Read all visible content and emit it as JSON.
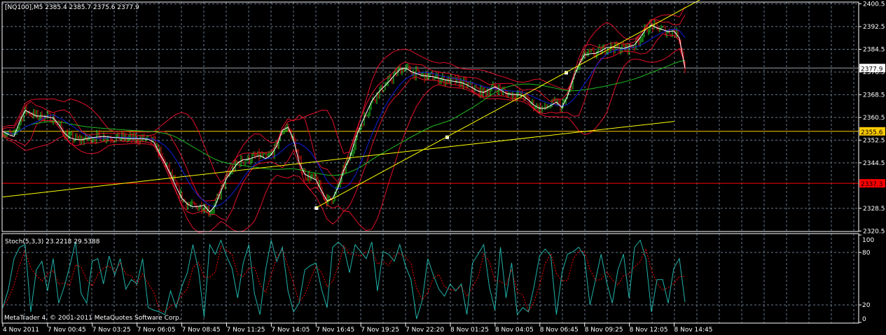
{
  "header": {
    "symbol_info": "[NQ100],M5  2385.4 2385.7 2375.6 2377.9"
  },
  "stoch_panel": {
    "label": "Stoch(5,3,3) 23.2218 29.5388",
    "copyright": "MetaTrader 4, © 2001-2011 MetaQuotes Software Corp."
  },
  "colors": {
    "background": "#000000",
    "grid": "#6a7a8c",
    "frame": "#ffffff",
    "bar_up": "#22dd22",
    "bar_down": "#ee1111",
    "ma_fast": "#ffffff",
    "ma_mid": "#1020e0",
    "ma_slow": "#22bb22",
    "bands": "#e0102a",
    "trendline": "#ffff00",
    "level_bid": "#9aa0a8",
    "level_yellow": "#ffcc00",
    "level_red": "#ff0000",
    "stoch_main": "#20b2aa",
    "stoch_signal": "#ff0000"
  },
  "chart_data": [
    {
      "type": "line",
      "title": "[NQ100],M5",
      "timeframe": "M5",
      "ohlc_last": {
        "open": 2385.4,
        "high": 2385.7,
        "low": 2375.6,
        "close": 2377.9
      },
      "y_ticks": [
        "2400.5",
        "2392.5",
        "2384.5",
        "2376.5",
        "2368.5",
        "2360.5",
        "2352.5",
        "2344.5",
        "2328.5",
        "2320.5"
      ],
      "ylim": [
        2320.5,
        2400.5
      ],
      "x_ticks": [
        "4 Nov 2011",
        "7 Nov 00:45",
        "7 Nov 03:25",
        "7 Nov 06:05",
        "7 Nov 08:45",
        "7 Nov 11:25",
        "7 Nov 14:05",
        "7 Nov 16:45",
        "7 Nov 19:25",
        "7 Nov 22:20",
        "8 Nov 01:25",
        "8 Nov 04:05",
        "8 Nov 06:45",
        "8 Nov 09:25",
        "8 Nov 12:05",
        "8 Nov 14:45"
      ],
      "grid": true,
      "price_levels": [
        {
          "label": "2377.9",
          "value": 2377.9,
          "color": "#9aa0a8",
          "label_bg": "#ffffff",
          "label_fg": "#000000"
        },
        {
          "label": "2355.6",
          "value": 2355.6,
          "color": "#ffcc00",
          "label_bg": "#ffcc00",
          "label_fg": "#000000"
        },
        {
          "label": "2337.3",
          "value": 2337.3,
          "color": "#ff0000",
          "label_bg": "#ff0000",
          "label_fg": "#000000"
        }
      ],
      "trendlines": [
        {
          "from": {
            "time": "4 Nov 2011",
            "price": 2332.5
          },
          "to": {
            "time": "8 Nov 14:45",
            "price": 2359.1
          }
        },
        {
          "from": {
            "time": "7 Nov 16:45",
            "price": 2328.7
          },
          "to": {
            "time": "8 Nov 14:45",
            "price": 2397.0
          }
        }
      ],
      "series": [
        {
          "values": [
            2355.6,
            2354.5,
            2353.8,
            2359,
            2363,
            2362,
            2361,
            2361,
            2360.7,
            2360.3,
            2358,
            2355,
            2353.3,
            2352.8,
            2352.6,
            2353,
            2353.4,
            2353.6,
            2353.8,
            2353.6,
            2353.4,
            2353.3,
            2353.1,
            2353,
            2353,
            2353,
            2352.8,
            2351.8,
            2348,
            2344.5,
            2340.5,
            2336,
            2332.1,
            2330,
            2329,
            2329.2,
            2329.5,
            2327.2,
            2329.5,
            2334.5,
            2339,
            2341.7,
            2344.5,
            2345.6,
            2345.8,
            2346.5,
            2347,
            2346,
            2347.3,
            2350.5,
            2356,
            2357,
            2352.6,
            2344.7,
            2340.5,
            2339.5,
            2338.5,
            2334.6,
            2331.2,
            2332,
            2336,
            2342,
            2346,
            2352.6,
            2357.7,
            2362,
            2366.3,
            2369,
            2371,
            2373,
            2375.3,
            2377.4,
            2377.9,
            2376.7,
            2375.9,
            2375.3,
            2375,
            2374.8,
            2374.3,
            2373.8,
            2373.4,
            2373.1,
            2372.8,
            2372,
            2370.9,
            2369.8,
            2369.3,
            2370.3,
            2371.3,
            2370.2,
            2369,
            2368.6,
            2368.6,
            2368.2,
            2366.6,
            2364.8,
            2363.7,
            2363.7,
            2364.7,
            2365.9,
            2364,
            2368,
            2374,
            2379,
            2382.5,
            2382.9,
            2383.1,
            2383.9,
            2385.1,
            2385.3,
            2385,
            2384.8,
            2385.4,
            2386.1,
            2388.7,
            2391.5,
            2393,
            2392,
            2391.4,
            2390.7,
            2391,
            2388.5,
            2377.9
          ]
        }
      ]
    },
    {
      "type": "line",
      "title": "Stoch(5,3,3) 23.2218 29.5388",
      "y_ticks": [
        "100",
        "80",
        "20",
        "0"
      ],
      "ylim": [
        0,
        100
      ],
      "last_main": 23.2218,
      "last_signal": 29.5388,
      "series": [
        {
          "values": [
            17,
            38,
            73,
            86,
            89,
            12,
            60,
            70,
            36,
            73,
            22,
            41,
            65,
            92,
            33,
            22,
            70,
            73,
            44,
            76,
            54,
            73,
            38,
            49,
            44,
            73,
            17,
            14,
            12,
            9,
            36,
            17,
            41,
            57,
            89,
            60,
            6,
            89,
            78,
            94,
            76,
            62,
            28,
            68,
            89,
            33,
            9,
            60,
            94,
            70,
            86,
            36,
            12,
            22,
            60,
            65,
            68,
            38,
            17,
            86,
            92,
            86,
            57,
            89,
            81,
            73,
            92,
            36,
            81,
            78,
            70,
            89,
            65,
            49,
            4,
            25,
            73,
            54,
            38,
            30,
            44,
            36,
            44,
            9,
            68,
            78,
            89,
            41,
            14,
            86,
            28,
            68,
            9,
            17,
            12,
            41,
            76,
            84,
            76,
            9,
            57,
            78,
            81,
            86,
            76,
            20,
            49,
            78,
            46,
            22,
            60,
            78,
            28,
            86,
            94,
            73,
            12,
            49,
            49,
            22,
            62,
            73,
            23.2
          ]
        }
      ]
    }
  ]
}
